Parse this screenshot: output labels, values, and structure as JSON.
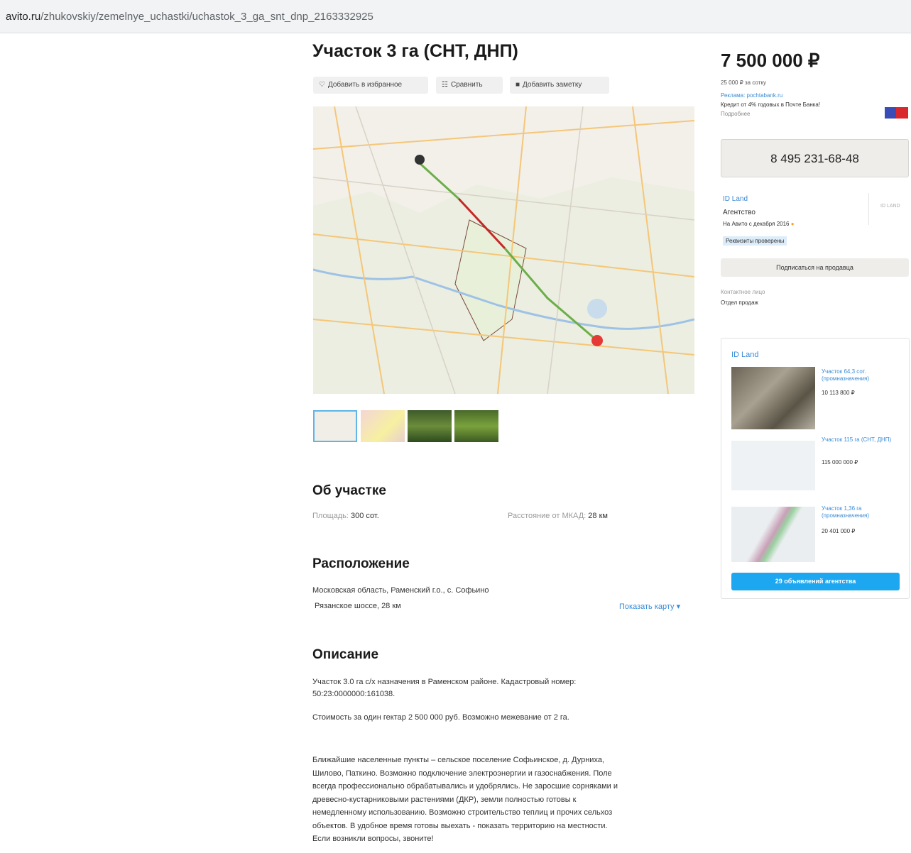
{
  "browser": {
    "url_host": "avito.ru",
    "url_path": "/zhukovskiy/zemelnye_uchastki/uchastok_3_ga_snt_dnp_2163332925"
  },
  "listing": {
    "title": "Участок 3 га (СНТ, ДНП)",
    "actions": {
      "favorite": "Добавить в избранное",
      "compare": "Сравнить",
      "note": "Добавить заметку"
    }
  },
  "about": {
    "heading": "Об участке",
    "area_label": "Площадь:",
    "area_value": "300 сот.",
    "distance_label": "Расстояние от МКАД:",
    "distance_value": "28 км"
  },
  "location": {
    "heading": "Расположение",
    "address": "Московская область, Раменский г.о., с. Софьино",
    "highway": "Рязанское шоссе, 28 км",
    "show_map": "Показать карту ▾"
  },
  "description": {
    "heading": "Описание",
    "p1": "Участок 3.0 га с/х назначения в Раменском районе. Кадастровый номер:",
    "p1b": "50:23:0000000:161038.",
    "p2": "Стоимость за один гектар 2 500 000 руб. Возможно межевание от 2 га.",
    "p3": [
      "Ближайшие населенные пункты – сельское поселение Софьинское, д. Дурниха,",
      "Шилово, Паткино. Возможно подключение электроэнергии и газоснабжения. Поле",
      "всегда профессионально обрабатывались и удобрялись. Не заросшие сорняками и",
      "древесно-кустарниковыми растениями (ДКР), земли полностью готовы к",
      "немедленному использованию. Возможно строительство теплиц и прочих сельхоз",
      "объектов. В удобное время готовы выехать - показать территорию на местности.",
      "Если возникли вопросы, звоните!"
    ]
  },
  "sidebar": {
    "price": "7 500 000 ₽",
    "price_per": "25 000 ₽ за сотку",
    "ad_label": "Реклама: pochtabank.ru",
    "credit": "Кредит от 4% годовых в Почте Банка!",
    "more": "Подробнее",
    "phone": "8 495 231-68-48",
    "seller_name": "ID Land",
    "seller_type": "Агентство",
    "seller_since": "На Авито с декабря 2016",
    "verified": "Реквизиты проверены",
    "seller_logo": "ID LAND",
    "subscribe": "Подписаться на продавца",
    "contact_label": "Контактное лицо",
    "contact_name": "Отдел продаж"
  },
  "agency": {
    "name": "ID Land",
    "ads": [
      {
        "title": "Участок 64,3 сот. (промназначения)",
        "price": "10 113 800 ₽"
      },
      {
        "title": "Участок 115 га (СНТ, ДНП)",
        "price": "115 000 000 ₽"
      },
      {
        "title": "Участок 1,36 га (промназначения)",
        "price": "20 401 000 ₽"
      }
    ],
    "button": "29 объявлений агентства"
  },
  "colors": {
    "accent": "#1ca7f0",
    "link": "#3a8bd6",
    "route_green": "#4caf50",
    "route_red": "#c62828"
  }
}
